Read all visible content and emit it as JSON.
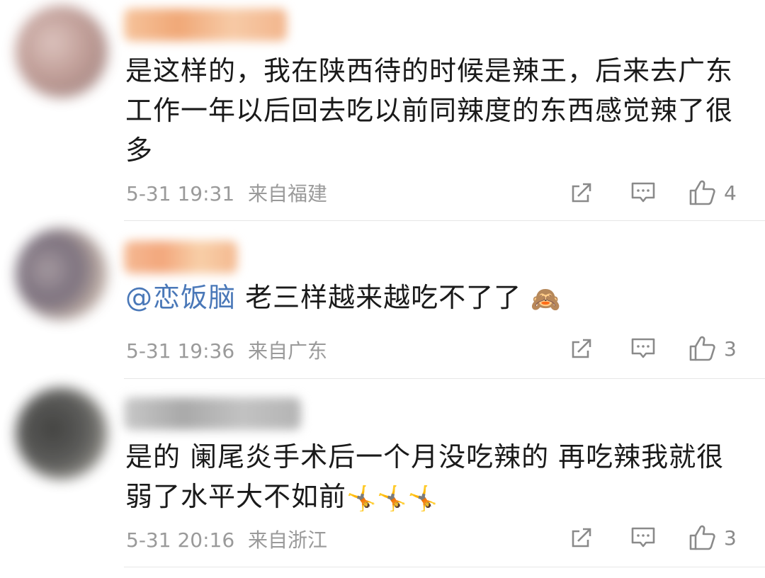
{
  "comments": [
    {
      "text": "是这样的，我在陕西待的时候是辣王，后来去广东工作一年以后回去吃以前同辣度的东西感觉辣了很多",
      "date": "5-31 19:31",
      "location": "来自福建",
      "likes": "4",
      "colors": {
        "avatar": "#b9938c",
        "username": "#f3b58c"
      }
    },
    {
      "mention": "@恋饭脑",
      "text": " 老三样越来越吃不了了",
      "emojis": [
        "🙈"
      ],
      "date": "5-31 19:36",
      "location": "来自广东",
      "likes": "3",
      "colors": {
        "avatar": "#7d6f78",
        "username": "#f2b58d"
      }
    },
    {
      "text": "是的 阑尾炎手术后一个月没吃辣的 再吃辣我就很弱了水平大不如前",
      "emojis": [
        "🤸",
        "🤸",
        "🤸"
      ],
      "date": "5-31 20:16",
      "location": "来自浙江",
      "likes": "3",
      "colors": {
        "avatar": "#4a4a48",
        "username": "#b4b4b4"
      }
    }
  ],
  "icons": {
    "share": "share-icon",
    "comment": "comment-icon",
    "like": "thumbs-up-icon"
  },
  "colors": {
    "text": "#1a1a1a",
    "meta": "#9a9a9a",
    "mention": "#4a78b8",
    "divider": "#e6e6e6"
  }
}
